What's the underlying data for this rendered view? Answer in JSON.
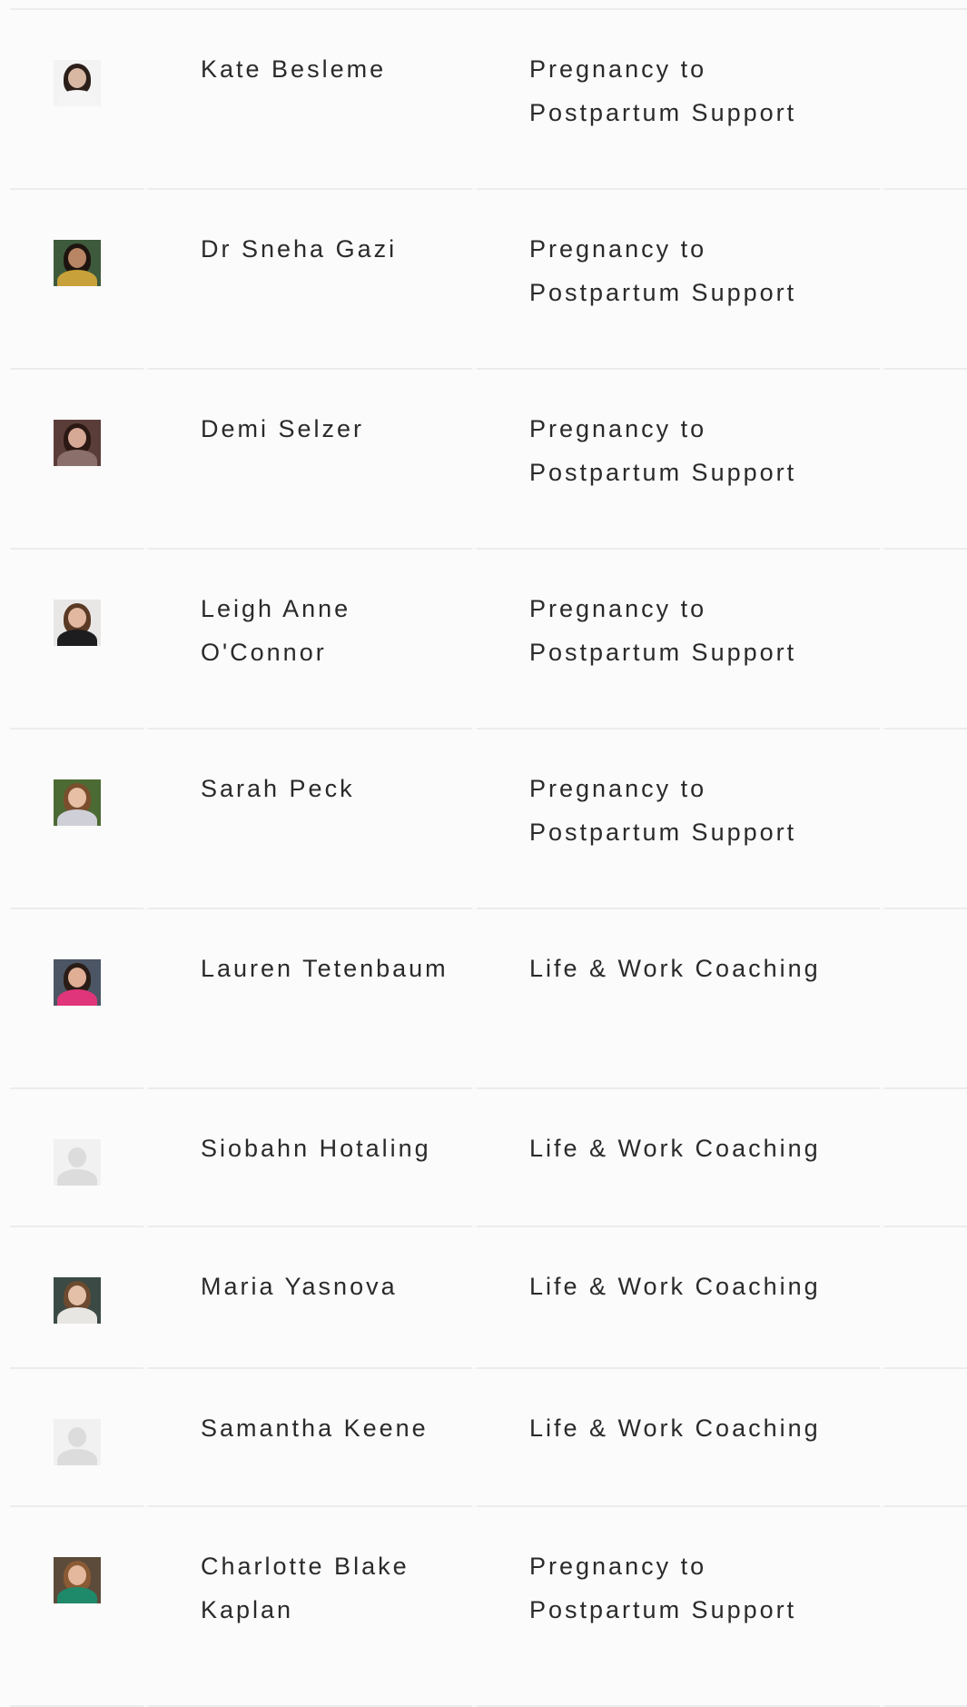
{
  "rows": [
    {
      "name": "Kate Besleme",
      "specialty": "Pregnancy to Postpartum Support",
      "photo": "person-photo",
      "avatar": {
        "bg": "#f4f3f3",
        "hair": "#2b1e19",
        "skin": "#d8b8a3",
        "body": "#f5f5f5"
      }
    },
    {
      "name": "Dr Sneha Gazi",
      "specialty": "Pregnancy to Postpartum Support",
      "photo": "person-photo",
      "avatar": {
        "bg": "#3e5a3c",
        "hair": "#1e140f",
        "skin": "#b88565",
        "body": "#c9a13a"
      }
    },
    {
      "name": "Demi Selzer",
      "specialty": "Pregnancy to Postpartum Support",
      "photo": "person-photo",
      "avatar": {
        "bg": "#5a3d38",
        "hair": "#2c1813",
        "skin": "#d6a896",
        "body": "#8a6f6a"
      }
    },
    {
      "name": "Leigh Anne O'Connor",
      "specialty": "Pregnancy to Postpartum Support",
      "photo": "person-photo",
      "avatar": {
        "bg": "#e9e7e5",
        "hair": "#5b3a25",
        "skin": "#e2b9a0",
        "body": "#1d1d1f"
      }
    },
    {
      "name": "Sarah Peck",
      "specialty": "Pregnancy to Postpartum Support",
      "photo": "person-photo",
      "avatar": {
        "bg": "#4c6a34",
        "hair": "#7a4e2d",
        "skin": "#e7bfa5",
        "body": "#cfcfd8"
      }
    },
    {
      "name": "Lauren Tetenbaum",
      "specialty": "Life & Work Coaching",
      "photo": "person-photo",
      "avatar": {
        "bg": "#4b5564",
        "hair": "#2a1c16",
        "skin": "#dfae95",
        "body": "#e0357a"
      }
    },
    {
      "name": "Siobahn Hotaling",
      "specialty": "Life & Work Coaching",
      "photo": "placeholder-avatar",
      "avatar": {
        "bg": "#f1f1f1",
        "hair": "#d9d9d9",
        "skin": "#dcdcdc",
        "body": "#dcdcdc"
      }
    },
    {
      "name": "Maria Yasnova",
      "specialty": "Life & Work Coaching",
      "photo": "person-photo",
      "avatar": {
        "bg": "#3b4a45",
        "hair": "#6b4a30",
        "skin": "#e4c0a8",
        "body": "#e8e6e2"
      }
    },
    {
      "name": "Samantha Keene",
      "specialty": "Life & Work Coaching",
      "photo": "placeholder-avatar",
      "avatar": {
        "bg": "#f1f1f1",
        "hair": "#d9d9d9",
        "skin": "#dcdcdc",
        "body": "#dcdcdc"
      }
    },
    {
      "name": "Charlotte Blake Kaplan",
      "specialty": "Pregnancy to Postpartum Support",
      "photo": "person-photo",
      "avatar": {
        "bg": "#5c4b3a",
        "hair": "#8a5a35",
        "skin": "#e3b89c",
        "body": "#1f8a6a"
      }
    }
  ]
}
